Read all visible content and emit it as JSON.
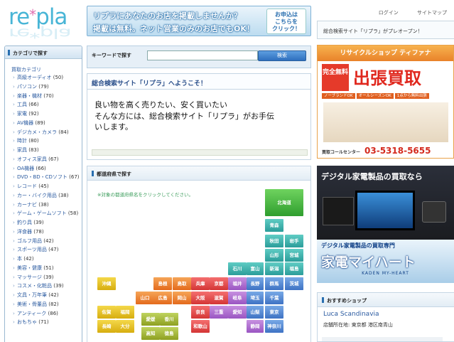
{
  "logo": {
    "text_pre": "re",
    "text_star": "*",
    "text_post": "pla",
    "reflection": "re*pla"
  },
  "top_banner": {
    "line1": "リプラにあなたのお店を掲載しませんか？",
    "line2": "掲載は無料。ネット営業のみのお店でもOK！",
    "cta": "お申込は\nこちらを\nクリック！"
  },
  "header": {
    "login": "ログイン",
    "sitemap": "サイトマップ",
    "notice": "総合検索サイト「リプラ」がプレオープン！"
  },
  "sidebar": {
    "title": "カテゴリで探す",
    "root": "買取カテゴリ",
    "items": [
      {
        "label": "高級オーディオ",
        "count": "(50)"
      },
      {
        "label": "パソコン",
        "count": "(79)"
      },
      {
        "label": "楽器・機材",
        "count": "(70)"
      },
      {
        "label": "工具",
        "count": "(66)"
      },
      {
        "label": "家電",
        "count": "(92)"
      },
      {
        "label": "AV機器",
        "count": "(89)"
      },
      {
        "label": "デジカメ・カメラ",
        "count": "(84)"
      },
      {
        "label": "時計",
        "count": "(80)"
      },
      {
        "label": "家具",
        "count": "(83)"
      },
      {
        "label": "オフィス家具",
        "count": "(67)"
      },
      {
        "label": "OA機器",
        "count": "(66)"
      },
      {
        "label": "DVD・BD・CDソフト",
        "count": "(67)"
      },
      {
        "label": "レコード",
        "count": "(45)"
      },
      {
        "label": "カー・バイク用品",
        "count": "(38)"
      },
      {
        "label": "カーナビ",
        "count": "(38)"
      },
      {
        "label": "ゲーム・ゲームソフト",
        "count": "(58)"
      },
      {
        "label": "釣り具",
        "count": "(39)"
      },
      {
        "label": "洋食器",
        "count": "(78)"
      },
      {
        "label": "ゴルフ用品",
        "count": "(42)"
      },
      {
        "label": "スポーツ用品",
        "count": "(47)"
      },
      {
        "label": "本",
        "count": "(42)"
      },
      {
        "label": "美容・健康",
        "count": "(51)"
      },
      {
        "label": "マッサージ",
        "count": "(39)"
      },
      {
        "label": "コスメ・化粧品",
        "count": "(39)"
      },
      {
        "label": "文具・万年筆",
        "count": "(42)"
      },
      {
        "label": "美術・骨董品",
        "count": "(82)"
      },
      {
        "label": "アンティーク",
        "count": "(86)"
      },
      {
        "label": "おもちゃ",
        "count": "(71)"
      }
    ]
  },
  "search": {
    "label": "キーワードで探す",
    "value": "",
    "button": "検索"
  },
  "welcome": {
    "title": "総合検索サイト「リプラ」へようこそ！",
    "line1": "良い物を高く売りたい、安く買いたい",
    "line2": "そんな方には、総合検索サイト「リプラ」がお手伝",
    "line3": "いします。"
  },
  "pref": {
    "title": "都道府県で探す",
    "note": "※対象の都道府県名をクリックしてください。",
    "items": [
      "北海道",
      "青森",
      "秋田",
      "岩手",
      "山形",
      "宮城",
      "石川",
      "富山",
      "新潟",
      "福島",
      "島根",
      "鳥取",
      "兵庫",
      "京都",
      "福井",
      "長野",
      "群馬",
      "栃木",
      "茨城",
      "沖縄",
      "山口",
      "広島",
      "岡山",
      "大阪",
      "滋賀",
      "岐阜",
      "埼玉",
      "千葉",
      "佐賀",
      "福岡",
      "愛媛",
      "香川",
      "奈良",
      "三重",
      "愛知",
      "山梨",
      "東京",
      "長崎",
      "大分",
      "高知",
      "徳島",
      "和歌山",
      "静岡",
      "神奈川"
    ]
  },
  "ad1": {
    "header": "リサイクルショップ ティファナ",
    "badge": "完全無料",
    "headline": "出張買取",
    "tags": [
      "ノーブランドOK",
      "オールシーズンOK",
      "1点から無料出張"
    ],
    "phone_label": "買取コールセンター",
    "phone": "03-5318-5655"
  },
  "ad2": {
    "header": "デジタル家電製品の買取なら",
    "sub": "デジタル家電製品の買取専門",
    "brand": "家電マイハート",
    "brand_en": "KADEN MY-HEART"
  },
  "recommend": {
    "title": "おすすめショップ",
    "shop": "Luca Scandinavia",
    "addr_label": "店舗所在地:",
    "addr": "東京都 港区南青山"
  }
}
